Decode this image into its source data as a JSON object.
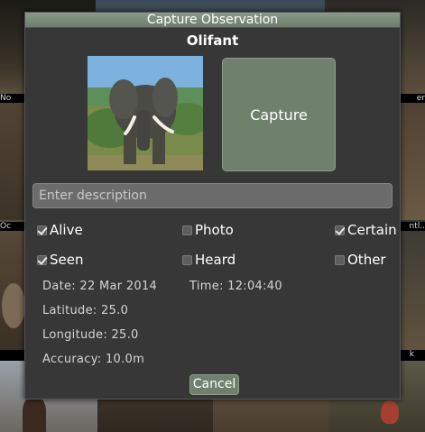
{
  "background": {
    "labels": [
      "No",
      "er",
      "Oc",
      "ntl..",
      "k"
    ]
  },
  "dialog": {
    "title": "Capture Observation",
    "species": "Olifant",
    "capture_label": "Capture",
    "description_placeholder": "Enter description",
    "checkboxes": [
      {
        "label": "Alive",
        "checked": true
      },
      {
        "label": "Photo",
        "checked": false
      },
      {
        "label": "Certain",
        "checked": true
      },
      {
        "label": "Seen",
        "checked": true
      },
      {
        "label": "Heard",
        "checked": false
      },
      {
        "label": "Other",
        "checked": false
      }
    ],
    "date_label": "Date:",
    "date_value": "22 Mar 2014",
    "time_label": "Time:",
    "time_value": "12:04:40",
    "latitude_label": "Latitude:",
    "latitude_value": "25.0",
    "longitude_label": "Longitude:",
    "longitude_value": "25.0",
    "accuracy_label": "Accuracy:",
    "accuracy_value": "10.0m",
    "cancel_label": "Cancel"
  },
  "colors": {
    "dialog_bg": "#373737",
    "button_green": "#6f816d",
    "titlebar": "#7d8d7b"
  }
}
